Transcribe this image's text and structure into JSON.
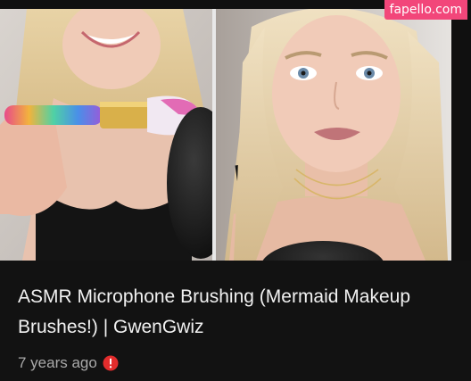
{
  "watermark": {
    "text": "fapello.com"
  },
  "video": {
    "title": "ASMR Microphone Brushing (Mermaid Makeup Brushes!) | GwenGwiz",
    "age": "7 years ago",
    "thumbnail_left_alt": "woman holding a rainbow makeup brush to a microphone",
    "thumbnail_right_alt": "woman smiling toward camera behind a microphone"
  },
  "icons": {
    "alert": "alert-circle-icon"
  },
  "colors": {
    "background": "#121212",
    "title_text": "#f1f1f1",
    "meta_text": "#aaaaaa",
    "alert_red": "#e22c2c",
    "watermark_bg": "#f2467a"
  }
}
